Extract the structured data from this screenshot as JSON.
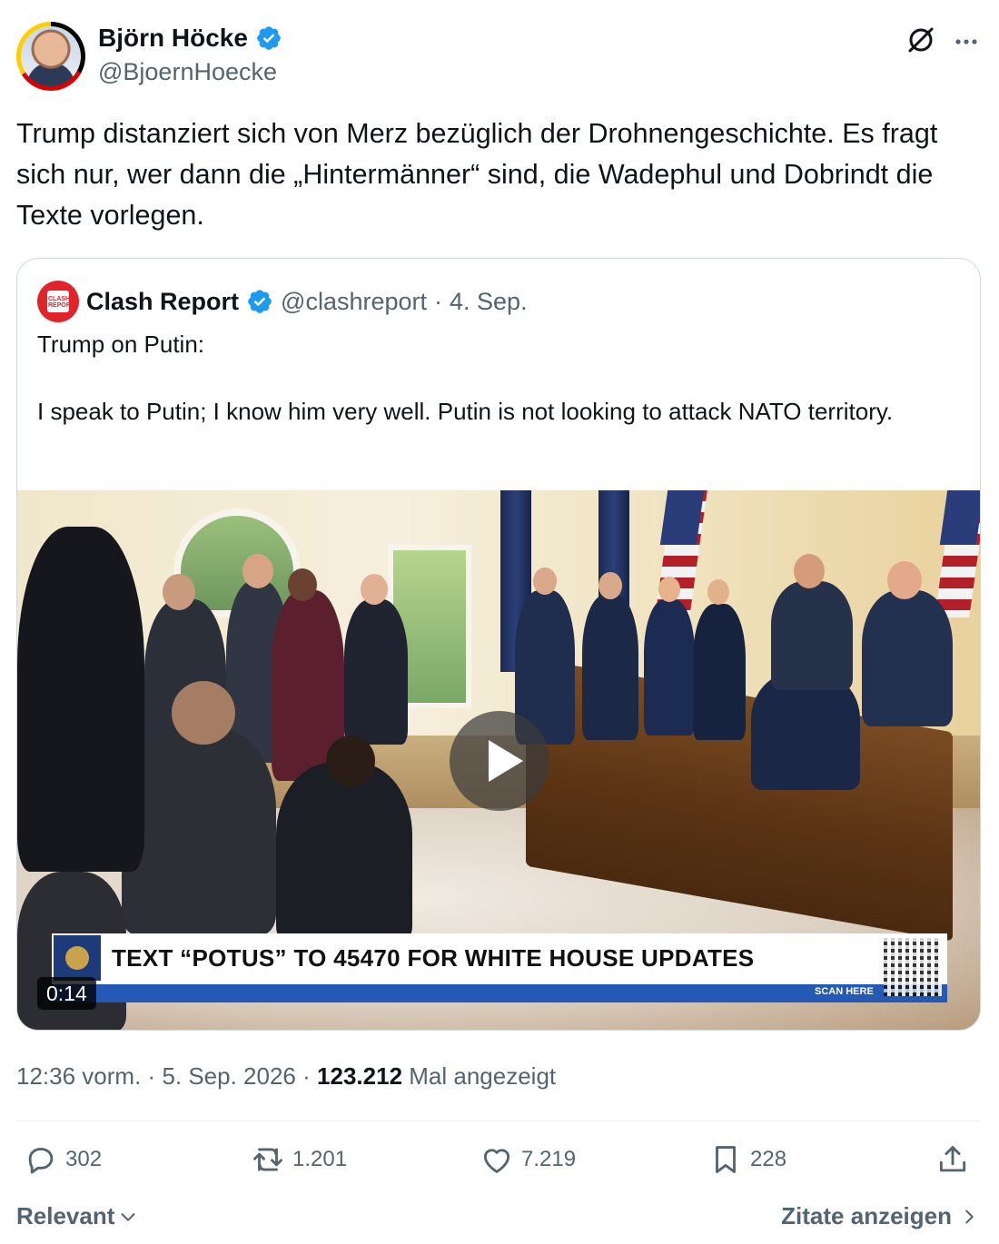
{
  "author": {
    "name": "Björn Höcke",
    "handle": "@BjoernHoecke",
    "verified": true
  },
  "tweet": {
    "text": "Trump distanziert sich von Merz bezüglich der Drohnengeschichte. Es fragt sich nur, wer dann die „Hintermänner“ sind, die Wadephul und Dobrindt die Texte vorlegen."
  },
  "quote": {
    "name": "Clash Report",
    "handle": "@clashreport",
    "separator": "·",
    "date": "4. Sep.",
    "text": "Trump on Putin:\n\nI speak to Putin; I know him very well. Putin is not looking to attack NATO territory.",
    "logo_text": "CLASH REPORT",
    "video": {
      "banner_text": "TEXT “POTUS” TO 45470 FOR WHITE HOUSE UPDATES",
      "scan_text": "SCAN HERE",
      "duration": "0:14"
    }
  },
  "meta": {
    "time": "12:36 vorm.",
    "sep1": "·",
    "date": "5. Sep. 2026",
    "sep2": "·",
    "views_count": "123.212",
    "views_label": "Mal angezeigt"
  },
  "actions": {
    "replies": "302",
    "reposts": "1.201",
    "likes": "7.219",
    "bookmarks": "228"
  },
  "footer": {
    "sort_label": "Relevant",
    "quotes_label": "Zitate anzeigen"
  },
  "colors": {
    "verified": "#1d9bf0",
    "secondary_text": "#536471",
    "primary_text": "#0f1419",
    "border": "#cfd9de"
  },
  "icons": [
    "verified-badge-icon",
    "grok-icon",
    "more-icon",
    "reply-icon",
    "repost-icon",
    "like-icon",
    "bookmark-icon",
    "share-icon",
    "play-icon",
    "chevron-down-icon",
    "chevron-right-icon"
  ]
}
